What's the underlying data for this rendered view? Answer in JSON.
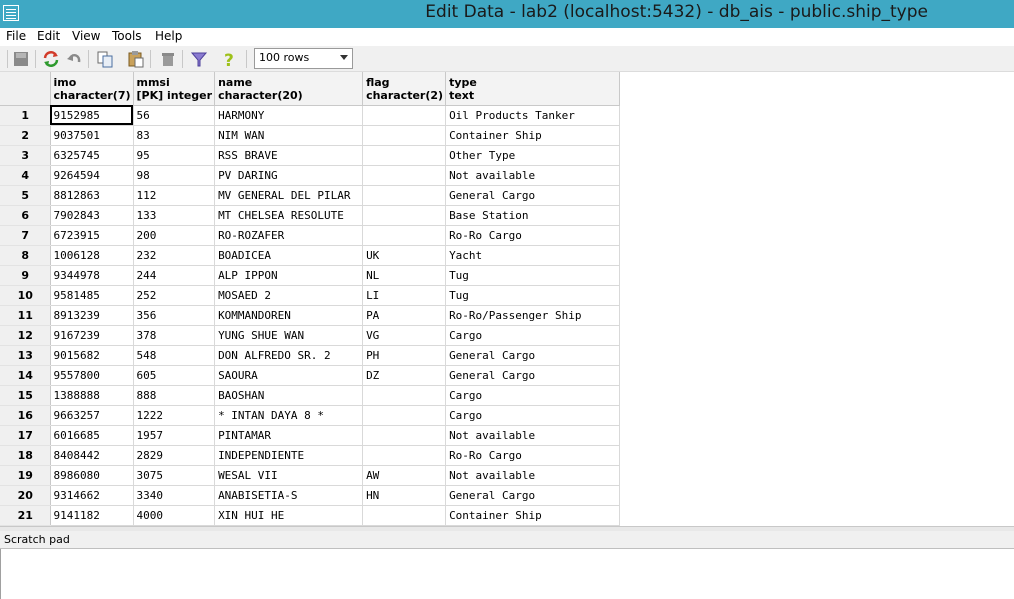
{
  "window": {
    "title": "Edit Data - lab2 (localhost:5432) - db_ais - public.ship_type",
    "titlebar_color": "#3fa8c4"
  },
  "menu": [
    {
      "label": "File"
    },
    {
      "label": "Edit"
    },
    {
      "label": "View"
    },
    {
      "label": "Tools"
    },
    {
      "label": "Help"
    }
  ],
  "toolbar": {
    "buttons": [
      "save-icon",
      "refresh-icon",
      "undo-icon",
      "copy-icon",
      "paste-icon",
      "delete-icon",
      "filter-icon",
      "help-icon"
    ],
    "rows_limit": "100 rows"
  },
  "grid": {
    "columns": [
      {
        "name": "imo",
        "type": "character(7)"
      },
      {
        "name": "mmsi",
        "type": "[PK] integer"
      },
      {
        "name": "name",
        "type": "character(20)"
      },
      {
        "name": "flag",
        "type": "character(2)"
      },
      {
        "name": "type",
        "type": "text"
      }
    ],
    "rows": [
      {
        "n": "1",
        "imo": "9152985",
        "mmsi": "56",
        "name": "HARMONY",
        "flag": "",
        "type": "Oil Products Tanker"
      },
      {
        "n": "2",
        "imo": "9037501",
        "mmsi": "83",
        "name": "NIM WAN",
        "flag": "",
        "type": "Container Ship"
      },
      {
        "n": "3",
        "imo": "6325745",
        "mmsi": "95",
        "name": "RSS BRAVE",
        "flag": "",
        "type": "Other Type"
      },
      {
        "n": "4",
        "imo": "9264594",
        "mmsi": "98",
        "name": "PV DARING",
        "flag": "",
        "type": "Not available"
      },
      {
        "n": "5",
        "imo": "8812863",
        "mmsi": "112",
        "name": "MV GENERAL DEL PILAR",
        "flag": "",
        "type": "General Cargo"
      },
      {
        "n": "6",
        "imo": "7902843",
        "mmsi": "133",
        "name": "MT CHELSEA RESOLUTE",
        "flag": "",
        "type": "Base Station"
      },
      {
        "n": "7",
        "imo": "6723915",
        "mmsi": "200",
        "name": "RO-ROZAFER",
        "flag": "",
        "type": "Ro-Ro Cargo"
      },
      {
        "n": "8",
        "imo": "1006128",
        "mmsi": "232",
        "name": "BOADICEA",
        "flag": "UK",
        "type": "Yacht"
      },
      {
        "n": "9",
        "imo": "9344978",
        "mmsi": "244",
        "name": "ALP IPPON",
        "flag": "NL",
        "type": "Tug"
      },
      {
        "n": "10",
        "imo": "9581485",
        "mmsi": "252",
        "name": "MOSAED 2",
        "flag": "LI",
        "type": "Tug"
      },
      {
        "n": "11",
        "imo": "8913239",
        "mmsi": "356",
        "name": "KOMMANDOREN",
        "flag": "PA",
        "type": "Ro-Ro/Passenger Ship"
      },
      {
        "n": "12",
        "imo": "9167239",
        "mmsi": "378",
        "name": "YUNG SHUE WAN",
        "flag": "VG",
        "type": "Cargo"
      },
      {
        "n": "13",
        "imo": "9015682",
        "mmsi": "548",
        "name": "DON ALFREDO SR. 2",
        "flag": "PH",
        "type": "General Cargo"
      },
      {
        "n": "14",
        "imo": "9557800",
        "mmsi": "605",
        "name": "SAOURA",
        "flag": "DZ",
        "type": "General Cargo"
      },
      {
        "n": "15",
        "imo": "1388888",
        "mmsi": "888",
        "name": "BAOSHAN",
        "flag": "",
        "type": "Cargo"
      },
      {
        "n": "16",
        "imo": "9663257",
        "mmsi": "1222",
        "name": "* INTAN DAYA 8 *",
        "flag": "",
        "type": "Cargo"
      },
      {
        "n": "17",
        "imo": "6016685",
        "mmsi": "1957",
        "name": "PINTAMAR",
        "flag": "",
        "type": "Not available"
      },
      {
        "n": "18",
        "imo": "8408442",
        "mmsi": "2829",
        "name": "INDEPENDIENTE",
        "flag": "",
        "type": "Ro-Ro Cargo"
      },
      {
        "n": "19",
        "imo": "8986080",
        "mmsi": "3075",
        "name": "WESAL VII",
        "flag": "AW",
        "type": "Not available"
      },
      {
        "n": "20",
        "imo": "9314662",
        "mmsi": "3340",
        "name": "ANABISETIA-S",
        "flag": "HN",
        "type": "General Cargo"
      },
      {
        "n": "21",
        "imo": "9141182",
        "mmsi": "4000",
        "name": "XIN HUI HE",
        "flag": "",
        "type": "Container Ship"
      }
    ]
  },
  "scratch_pad": {
    "label": "Scratch pad",
    "content": ""
  }
}
